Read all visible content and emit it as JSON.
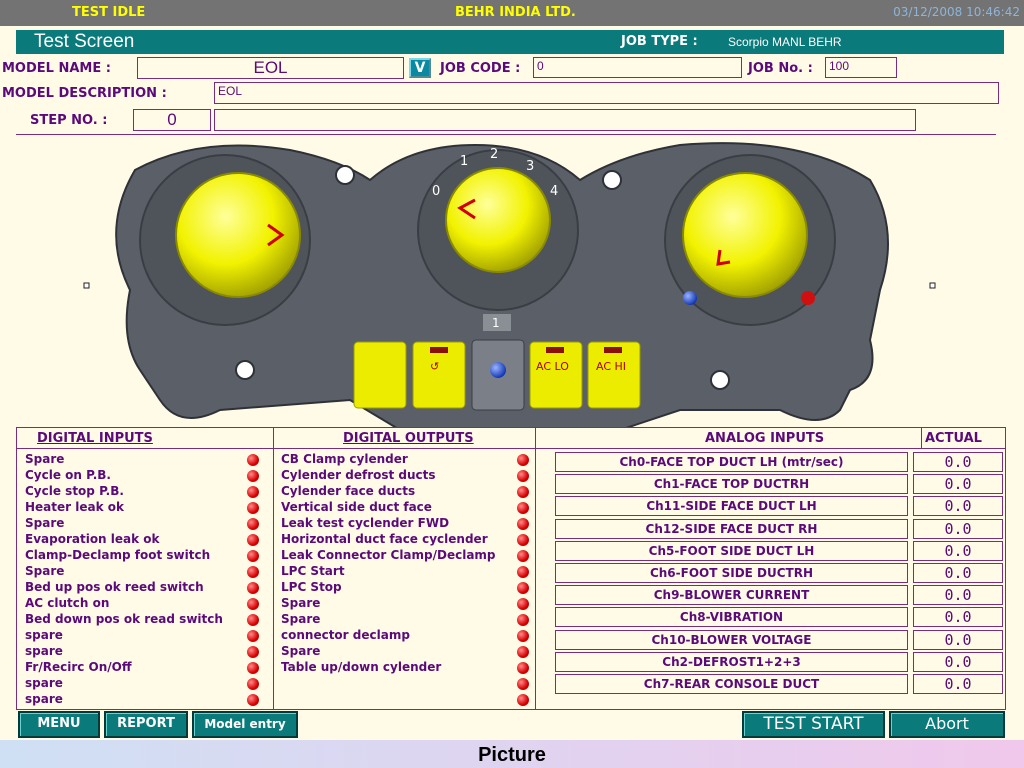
{
  "topbar": {
    "status": "TEST IDLE",
    "company": "BEHR INDIA LTD.",
    "datetime": "03/12/2008 10:46:42"
  },
  "header": {
    "screen_title": "Test Screen",
    "job_type_label": "JOB TYPE :",
    "job_type_value": "Scorpio  MANL     BEHR",
    "model_name_label": "MODEL NAME :",
    "model_name_value": "EOL",
    "dropdown_icon_label": "V",
    "job_code_label": "JOB CODE :",
    "job_code_value": "0",
    "job_no_label": "JOB No.  :",
    "job_no_value": "100",
    "model_desc_label": "MODEL DESCRIPTION  :",
    "model_desc_value": "EOL",
    "step_no_label": "STEP NO. :",
    "step_no_value": "0",
    "step_text_value": ""
  },
  "panel": {
    "blower_marks": [
      "0",
      "1",
      "2",
      "3",
      "4"
    ],
    "indicator_number": "1",
    "ac_lo_label": "AC LO",
    "ac_hi_label": "AC HI",
    "colors": {
      "body": "#5a5f66",
      "knob": "#ffff00",
      "button": "#ecec00",
      "indicator_red": "#8a1010",
      "dot_blue": "#1040c8",
      "dot_red": "#c81010"
    }
  },
  "tables": {
    "digital_inputs_header": "DIGITAL INPUTS",
    "digital_outputs_header": "DIGITAL OUTPUTS",
    "analog_inputs_header": "ANALOG INPUTS",
    "actual_header": "ACTUAL",
    "digital_inputs": [
      "Spare",
      "Cycle on P.B.",
      "Cycle stop P.B.",
      "Heater leak ok",
      "Spare",
      "Evaporation leak ok",
      "Clamp-Declamp foot switch",
      "Spare",
      "Bed up pos ok reed switch",
      "AC clutch on",
      "Bed down pos ok read switch",
      "spare",
      "spare",
      "Fr/Recirc On/Off",
      "spare",
      "spare"
    ],
    "digital_outputs": [
      "CB Clamp cylender",
      "Cylender defrost ducts",
      "Cylender face ducts",
      "Vertical side duct face",
      "Leak test cyclender FWD",
      "Horizontal duct face cyclender",
      "Leak Connector Clamp/Declamp",
      "LPC Start",
      "LPC Stop",
      "Spare",
      "Spare",
      "connector declamp",
      "Spare",
      "Table up/down cylender",
      "",
      ""
    ],
    "analog_inputs": [
      {
        "name": "Ch0-FACE TOP DUCT LH (mtr/sec)",
        "value": "0.0"
      },
      {
        "name": "Ch1-FACE TOP DUCTRH",
        "value": "0.0"
      },
      {
        "name": "Ch11-SIDE FACE DUCT LH",
        "value": "0.0"
      },
      {
        "name": "Ch12-SIDE FACE DUCT RH",
        "value": "0.0"
      },
      {
        "name": "Ch5-FOOT SIDE DUCT LH",
        "value": "0.0"
      },
      {
        "name": "Ch6-FOOT SIDE DUCTRH",
        "value": "0.0"
      },
      {
        "name": "Ch9-BLOWER CURRENT",
        "value": "0.0"
      },
      {
        "name": "Ch8-VIBRATION",
        "value": "0.0"
      },
      {
        "name": "Ch10-BLOWER VOLTAGE",
        "value": "0.0"
      },
      {
        "name": "Ch2-DEFROST1+2+3",
        "value": "0.0"
      },
      {
        "name": "Ch7-REAR CONSOLE DUCT",
        "value": "0.0"
      }
    ],
    "led_color": "#d80000"
  },
  "buttons": {
    "menu": "MENU",
    "report": "REPORT",
    "model_entry": "Model entry",
    "test_start": "TEST START",
    "abort": "Abort"
  },
  "footer": {
    "caption": "Picture"
  }
}
